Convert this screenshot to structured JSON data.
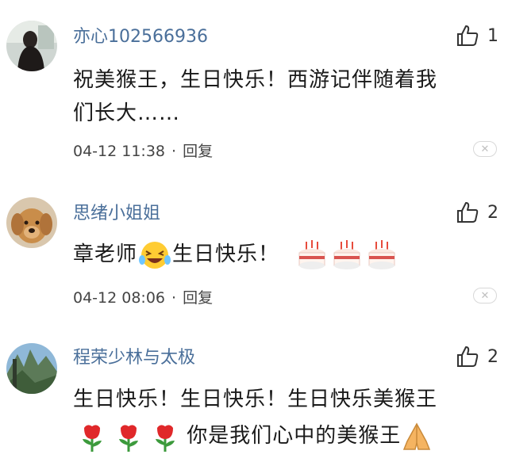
{
  "comments": [
    {
      "username": "亦心102566936",
      "likes": "1",
      "text_lines": [
        "祝美猴王，生日快乐！西游记伴随着我",
        "们长大……"
      ],
      "time": "04-12 11:38",
      "dot": "·",
      "reply_label": "回复",
      "close_glyph": "✕",
      "avatar_icon": "woman-silhouette-avatar"
    },
    {
      "username": "思绪小姐姐",
      "likes": "2",
      "text_parts": [
        "章老师",
        "生日快乐！"
      ],
      "emojis": [
        "laughing-face-icon",
        "birthday-cake-icon",
        "birthday-cake-icon",
        "birthday-cake-icon"
      ],
      "time": "04-12 08:06",
      "dot": "·",
      "reply_label": "回复",
      "close_glyph": "✕",
      "avatar_icon": "golden-retriever-avatar"
    },
    {
      "username": "程荣少林与太极",
      "likes": "2",
      "text_lines": [
        "生日快乐！生日快乐！生日快乐美猴王"
      ],
      "text_tail": "你是我们心中的美猴王",
      "emojis": [
        "rose-icon",
        "rose-icon",
        "rose-icon",
        "folded-hands-icon"
      ],
      "avatar_icon": "mountain-landscape-avatar"
    }
  ],
  "colors": {
    "username": "#4a6f9a",
    "text": "#1a1a1a",
    "meta": "#444444"
  }
}
